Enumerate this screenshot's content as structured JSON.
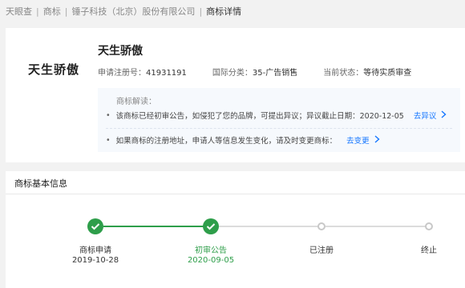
{
  "breadcrumb": [
    {
      "label": "天眼查"
    },
    {
      "label": "商标"
    },
    {
      "label": "锤子科技（北京）股份有限公司"
    },
    {
      "label": "商标详情"
    }
  ],
  "trademark": {
    "logo_text": "天生骄傲",
    "name": "天生骄傲",
    "reg_no_label": "申请注册号：",
    "reg_no": "41931191",
    "class_label": "国际分类：",
    "class_value": "35-广告销售",
    "status_label": "当前状态：",
    "status_value": "等待实质审查"
  },
  "notice": {
    "title": "商标解读：",
    "items": [
      {
        "text": "该商标已经初审公告，如侵犯了您的品牌，可提出异议；异议截止日期：2020-12-05",
        "link": "去异议"
      },
      {
        "text": "如果商标的注册地址，申请人等信息发生变化，请及时变更商标：",
        "link": "去变更"
      }
    ]
  },
  "basic_info": {
    "title": "商标基本信息",
    "steps": [
      {
        "label": "商标申请",
        "date": "2019-10-28",
        "state": "done"
      },
      {
        "label": "初审公告",
        "date": "2020-09-05",
        "state": "current"
      },
      {
        "label": "已注册",
        "date": "",
        "state": "pending"
      },
      {
        "label": "终止",
        "date": "",
        "state": "pending"
      }
    ]
  },
  "colors": {
    "done": "#2e9e4a",
    "pending": "#c8c8c8",
    "link": "#1677ff"
  }
}
